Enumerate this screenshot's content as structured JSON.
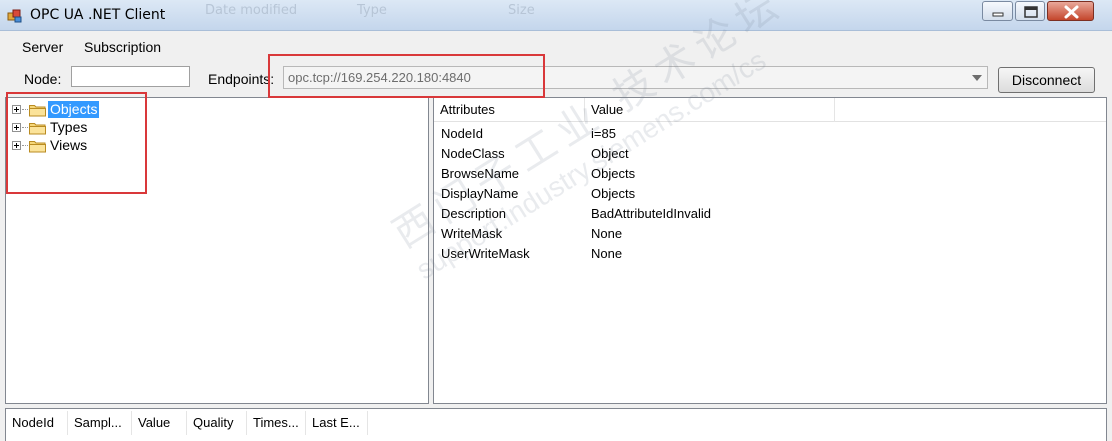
{
  "window": {
    "title": "OPC UA .NET Client",
    "background_headers": [
      "Date modified",
      "Type",
      "Size"
    ]
  },
  "menu": {
    "items": [
      "Server",
      "Subscription"
    ]
  },
  "toolbar": {
    "node_label": "Node:",
    "node_value": "",
    "endpoints_label": "Endpoints:",
    "endpoint_value": "opc.tcp://169.254.220.180:4840",
    "disconnect_label": "Disconnect"
  },
  "tree": {
    "nodes": [
      {
        "label": "Objects",
        "selected": true
      },
      {
        "label": "Types",
        "selected": false
      },
      {
        "label": "Views",
        "selected": false
      }
    ]
  },
  "attributes": {
    "columns": [
      "Attributes",
      "Value"
    ],
    "rows": [
      {
        "name": "NodeId",
        "value": "i=85"
      },
      {
        "name": "NodeClass",
        "value": "Object"
      },
      {
        "name": "BrowseName",
        "value": "Objects"
      },
      {
        "name": "DisplayName",
        "value": "Objects"
      },
      {
        "name": "Description",
        "value": "BadAttributeIdInvalid"
      },
      {
        "name": "WriteMask",
        "value": "None"
      },
      {
        "name": "UserWriteMask",
        "value": "None"
      }
    ]
  },
  "monitored": {
    "columns": [
      "NodeId",
      "Sampl...",
      "Value",
      "Quality",
      "Times...",
      "Last E..."
    ]
  },
  "watermark": {
    "line1": "西门子工业 技术论坛",
    "line2": "support.industry.siemens.com/cs"
  },
  "colors": {
    "selection": "#3399ff",
    "annotation_red": "#d9383a",
    "titlebar": "#c4d6ec"
  }
}
